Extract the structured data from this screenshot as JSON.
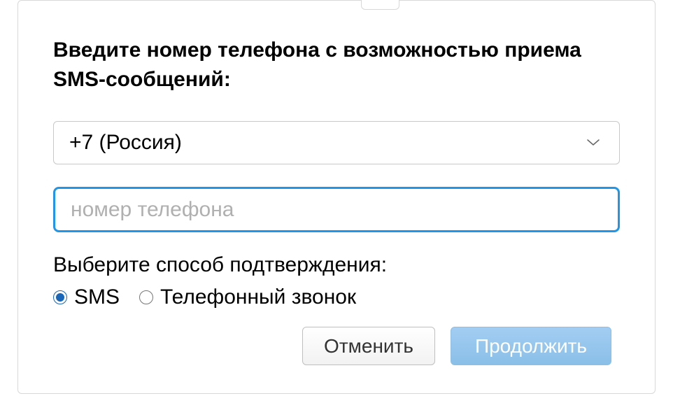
{
  "instruction": "Введите номер телефона с возможностью приема SMS-сообщений:",
  "country": {
    "selected_label": "+7 (Россия)"
  },
  "phone": {
    "value": "",
    "placeholder": "номер телефона"
  },
  "method": {
    "label": "Выберите способ подтверждения:",
    "options": {
      "sms": "SMS",
      "call": "Телефонный звонок"
    },
    "selected": "sms"
  },
  "buttons": {
    "cancel": "Отменить",
    "continue": "Продолжить"
  }
}
